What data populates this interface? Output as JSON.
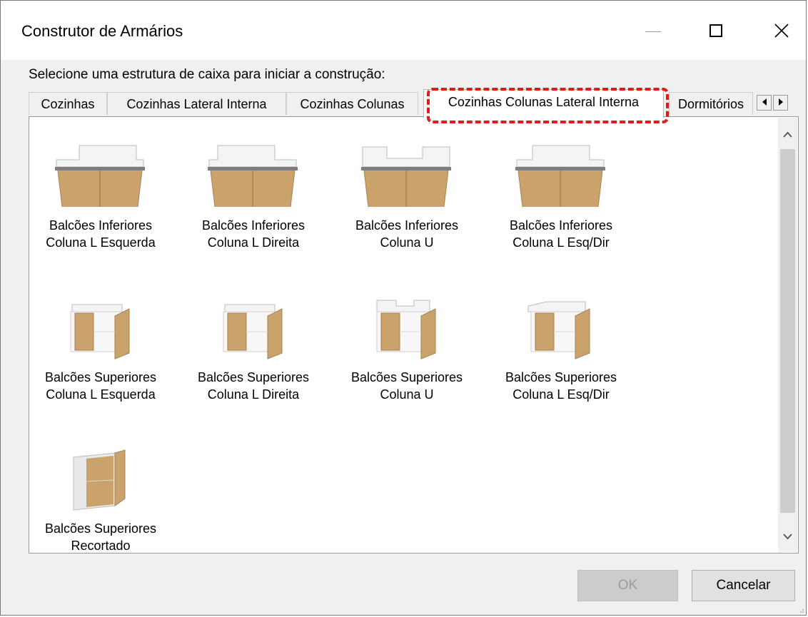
{
  "window": {
    "title": "Construtor de Armários"
  },
  "prompt": "Selecione uma estrutura de caixa para iniciar a construção:",
  "tabs": [
    {
      "label": "Cozinhas"
    },
    {
      "label": "Cozinhas Lateral Interna"
    },
    {
      "label": "Cozinhas Colunas"
    },
    {
      "label": "Cozinhas Colunas Lateral Interna",
      "selected": true
    },
    {
      "label": "Dormitórios"
    }
  ],
  "items": [
    {
      "line1": "Balcões Inferiores",
      "line2": "Coluna L Esquerda",
      "kind": "lower-l-left"
    },
    {
      "line1": "Balcões Inferiores",
      "line2": "Coluna L Direita",
      "kind": "lower-l-right"
    },
    {
      "line1": "Balcões Inferiores",
      "line2": "Coluna U",
      "kind": "lower-u"
    },
    {
      "line1": "Balcões Inferiores",
      "line2": "Coluna L Esq/Dir",
      "kind": "lower-l-both"
    },
    {
      "line1": "Balcões Superiores",
      "line2": "Coluna L Esquerda",
      "kind": "upper-l-left"
    },
    {
      "line1": "Balcões Superiores",
      "line2": "Coluna L Direita",
      "kind": "upper-l-right"
    },
    {
      "line1": "Balcões Superiores",
      "line2": "Coluna U",
      "kind": "upper-u"
    },
    {
      "line1": "Balcões Superiores",
      "line2": "Coluna L Esq/Dir",
      "kind": "upper-l-both"
    },
    {
      "line1": "Balcões Superiores",
      "line2": "Recortado",
      "kind": "upper-cutout"
    }
  ],
  "buttons": {
    "ok": "OK",
    "cancel": "Cancelar"
  },
  "colors": {
    "wood": "#c9a26c",
    "wood_dark": "#a9824f",
    "highlight": "#e21a1a"
  },
  "icons": {
    "minimize": "minimize-icon",
    "maximize": "maximize-icon",
    "close": "close-icon"
  }
}
